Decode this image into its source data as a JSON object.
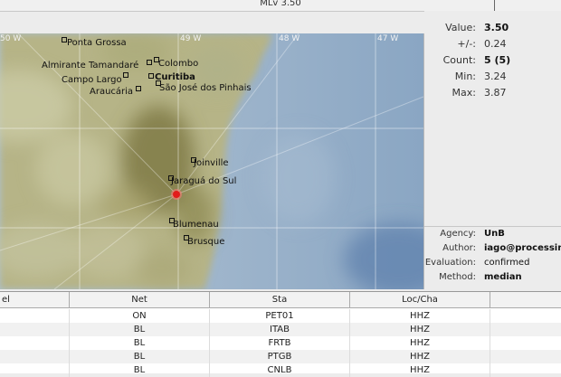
{
  "window": {
    "title": "MLv 3.50"
  },
  "map": {
    "longitude_labels": [
      "50 W",
      "49 W",
      "48 W",
      "47 W"
    ],
    "cities": [
      {
        "name": "Ponta Grossa"
      },
      {
        "name": "Almirante Tamandaré"
      },
      {
        "name": "Colombo"
      },
      {
        "name": "Campo Largo"
      },
      {
        "name": "Curitiba"
      },
      {
        "name": "Araucária"
      },
      {
        "name": "São José dos Pinhais"
      },
      {
        "name": "Joinville"
      },
      {
        "name": "Jaraguá do Sul"
      },
      {
        "name": "Blumenau"
      },
      {
        "name": "Brusque"
      }
    ],
    "colors": {
      "land": "#b7b686",
      "dark_land": "#8f8a55",
      "ocean": "#9bb3cc",
      "deep_ocean": "#6d8fb8",
      "epicenter": "#e21b1b"
    }
  },
  "magnitude": {
    "value_label": "Value:",
    "value": "3.50",
    "uncertainty_label": "+/-:",
    "uncertainty": "0.24",
    "count_label": "Count:",
    "count": "5 (5)",
    "min_label": "Min:",
    "min": "3.24",
    "max_label": "Max:",
    "max": "3.87"
  },
  "info": {
    "agency_label": "Agency:",
    "agency": "UnB",
    "author_label": "Author:",
    "author": "iago@processin",
    "evaluation_label": "Evaluation:",
    "evaluation": "confirmed",
    "method_label": "Method:",
    "method": "median"
  },
  "table": {
    "headers": [
      "el",
      "Net",
      "Sta",
      "Loc/Cha",
      ""
    ],
    "rows": [
      {
        "net": "ON",
        "sta": "PET01",
        "loccha": "HHZ"
      },
      {
        "net": "BL",
        "sta": "ITAB",
        "loccha": "HHZ"
      },
      {
        "net": "BL",
        "sta": "FRTB",
        "loccha": "HHZ"
      },
      {
        "net": "BL",
        "sta": "PTGB",
        "loccha": "HHZ"
      },
      {
        "net": "BL",
        "sta": "CNLB",
        "loccha": "HHZ"
      }
    ]
  }
}
